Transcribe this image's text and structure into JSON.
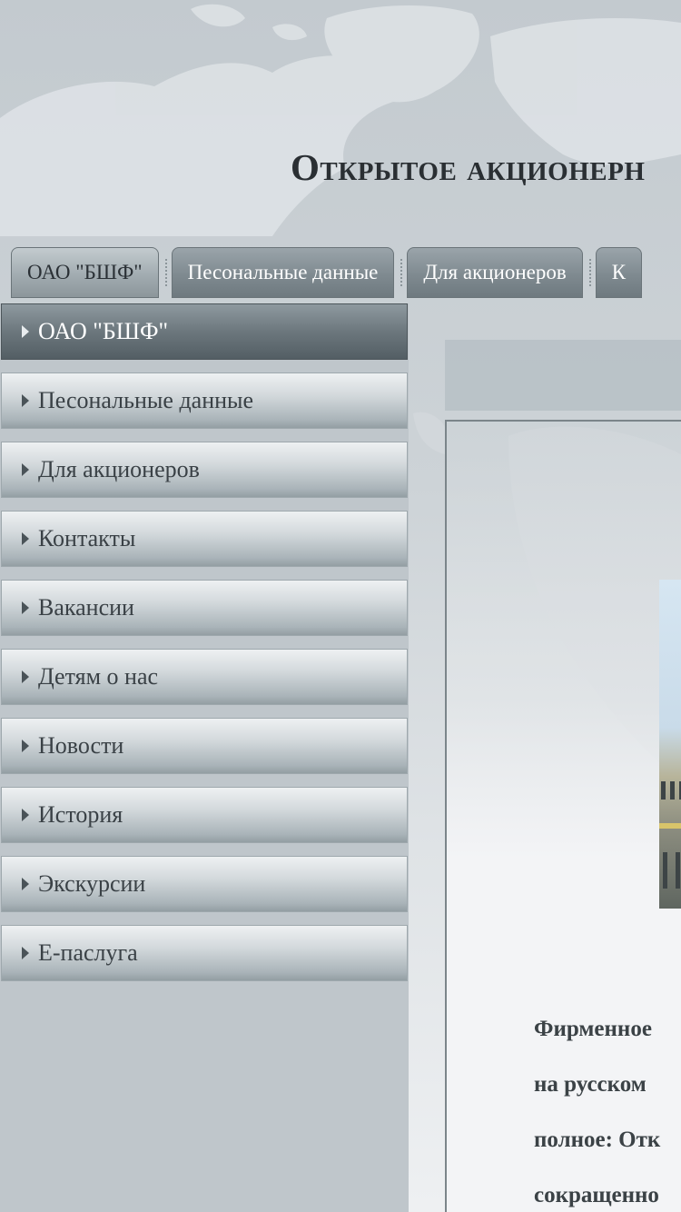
{
  "header": {
    "title": "Открытое акционерн"
  },
  "top_nav": {
    "items": [
      {
        "label": "ОАО \"БШФ\"",
        "active": true
      },
      {
        "label": "Песональные данные",
        "active": false
      },
      {
        "label": "Для акционеров",
        "active": false
      },
      {
        "label": "К",
        "active": false
      }
    ]
  },
  "sidebar": {
    "items": [
      {
        "label": "ОАО \"БШФ\"",
        "active": true
      },
      {
        "label": "Песональные данные",
        "active": false
      },
      {
        "label": "Для акционеров",
        "active": false
      },
      {
        "label": "Контакты",
        "active": false
      },
      {
        "label": "Вакансии",
        "active": false
      },
      {
        "label": "Детям о нас",
        "active": false
      },
      {
        "label": "Новости",
        "active": false
      },
      {
        "label": "История",
        "active": false
      },
      {
        "label": "Экскурсии",
        "active": false
      },
      {
        "label": "Е-паслуга",
        "active": false
      }
    ]
  },
  "content": {
    "lines": [
      "Фирменное",
      "на русском",
      "полное: Отк",
      "сокращенно"
    ]
  },
  "colors": {
    "active_tab": "#9fa9ae",
    "inactive_tab": "#7f8a90",
    "sidebar_active": "#6c777d",
    "title_text": "#2a2f33"
  }
}
